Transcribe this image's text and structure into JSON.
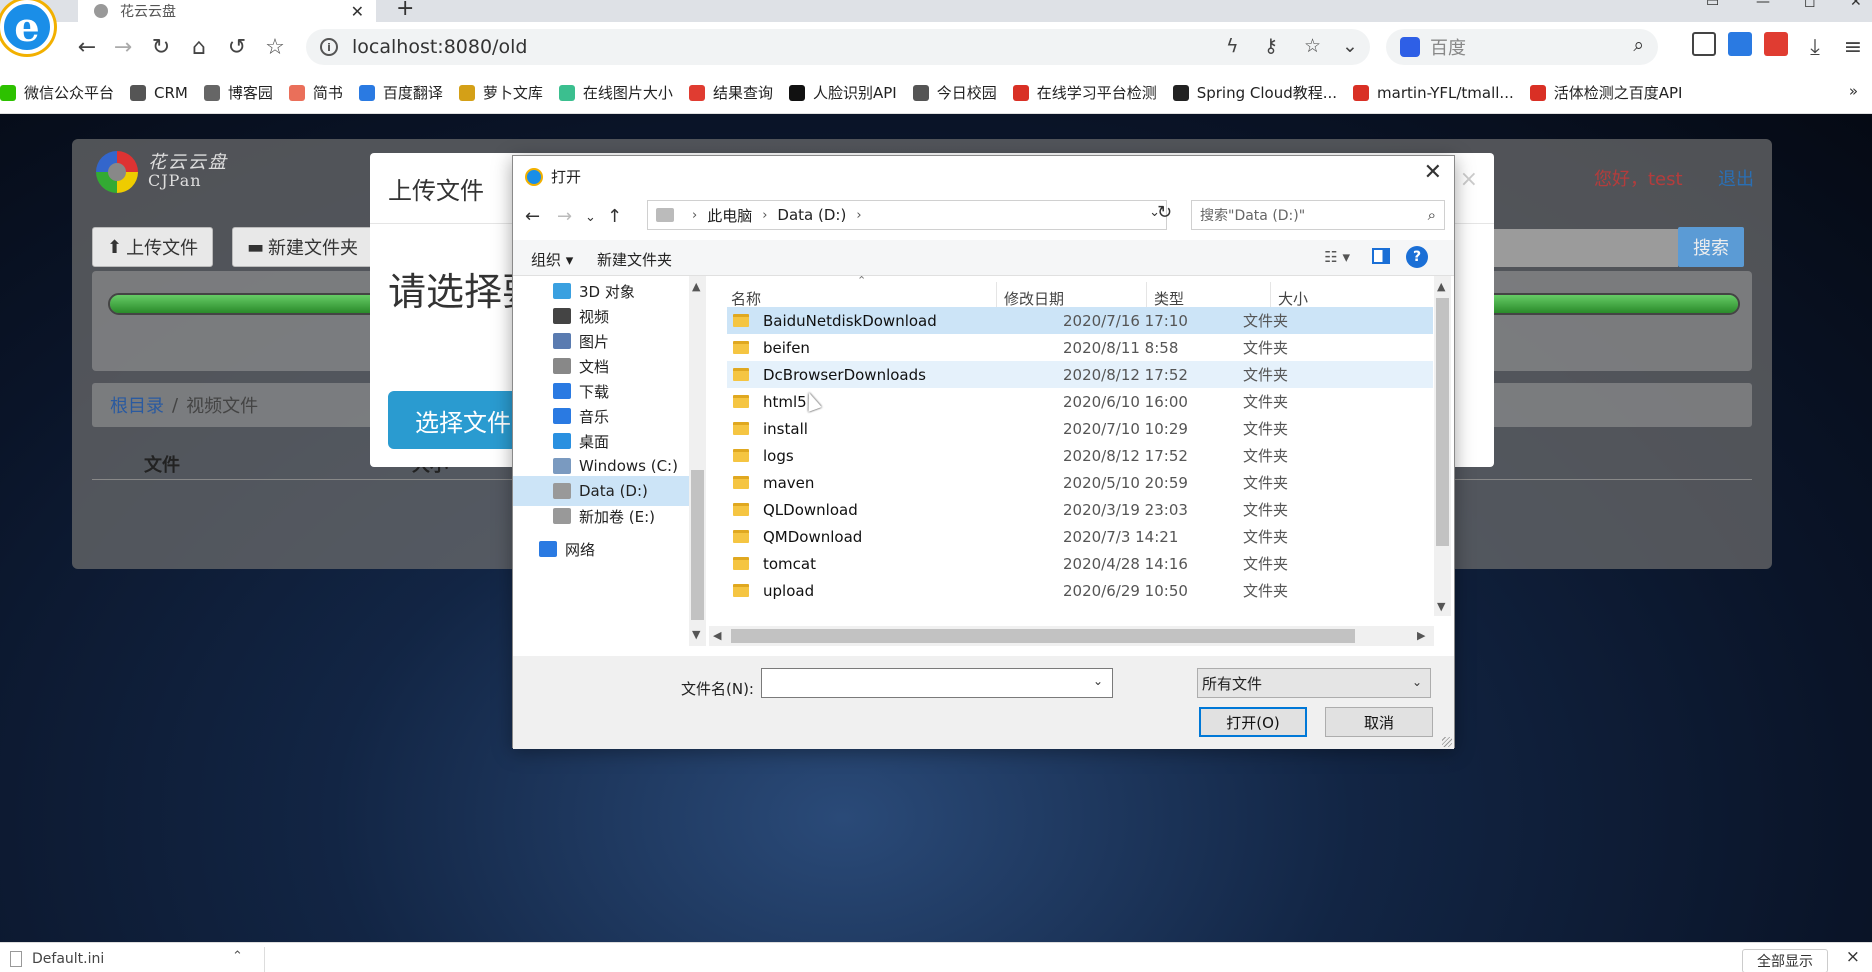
{
  "browser": {
    "tab_title": "花云云盘",
    "url": "localhost:8080/old",
    "search_placeholder": "百度",
    "bookmarks": [
      {
        "label": "微信公众平台",
        "color": "#2dc100"
      },
      {
        "label": "CRM",
        "color": "#555555"
      },
      {
        "label": "博客园",
        "color": "#666666"
      },
      {
        "label": "简书",
        "color": "#ea6f5a"
      },
      {
        "label": "百度翻译",
        "color": "#2a7ae2"
      },
      {
        "label": "萝卜文库",
        "color": "#d4a017"
      },
      {
        "label": "在线图片大小",
        "color": "#3bbf8f"
      },
      {
        "label": "结果查询",
        "color": "#e03c31"
      },
      {
        "label": "人脸识别API",
        "color": "#111111"
      },
      {
        "label": "今日校园",
        "color": "#555555"
      },
      {
        "label": "在线学习平台检测",
        "color": "#d93025"
      },
      {
        "label": "Spring Cloud教程...",
        "color": "#222222"
      },
      {
        "label": "martin-YFL/tmall...",
        "color": "#d93025"
      },
      {
        "label": "活体检测之百度API",
        "color": "#d93025"
      }
    ],
    "bookmarks_more": "»"
  },
  "app": {
    "logo_line1": "花云云盘",
    "logo_line2": "CJPan",
    "greeting": "您好，test",
    "logout": "退出",
    "upload_btn": "上传文件",
    "new_folder_btn": "新建文件夹",
    "search_btn": "搜索",
    "progress": 1.0,
    "breadcrumb_root": "根目录",
    "breadcrumb_sep": "/",
    "breadcrumb_current": "视频文件",
    "columns": [
      "文件",
      "大小"
    ]
  },
  "upload_modal": {
    "title": "上传文件",
    "close": "×",
    "prompt": "请选择要",
    "choose_btn": "选择文件"
  },
  "dialog": {
    "title": "打开",
    "path": [
      "此电脑",
      "Data (D:)"
    ],
    "search_placeholder": "搜索\"Data (D:)\"",
    "organize": "组织 ▾",
    "new_folder": "新建文件夹",
    "help": "?",
    "nav_items": [
      {
        "label": "3D 对象",
        "icon": "cube-icon",
        "color": "#3aa0e0",
        "selected": false
      },
      {
        "label": "视频",
        "icon": "video-icon",
        "color": "#444444",
        "selected": false
      },
      {
        "label": "图片",
        "icon": "picture-icon",
        "color": "#5a7bb0",
        "selected": false
      },
      {
        "label": "文档",
        "icon": "document-icon",
        "color": "#888888",
        "selected": false
      },
      {
        "label": "下载",
        "icon": "download-icon",
        "color": "#2a7ae2",
        "selected": false
      },
      {
        "label": "音乐",
        "icon": "music-icon",
        "color": "#2a7ae2",
        "selected": false
      },
      {
        "label": "桌面",
        "icon": "desktop-icon",
        "color": "#2a90e0",
        "selected": false
      },
      {
        "label": "Windows (C:)",
        "icon": "drive-icon",
        "color": "#7a9ac0",
        "selected": false
      },
      {
        "label": "Data (D:)",
        "icon": "drive-icon",
        "color": "#999999",
        "selected": true
      },
      {
        "label": "新加卷 (E:)",
        "icon": "drive-icon",
        "color": "#999999",
        "selected": false
      },
      {
        "label": "网络",
        "icon": "network-icon",
        "color": "#2a7ae2",
        "selected": false
      }
    ],
    "headers": {
      "name": "名称",
      "date": "修改日期",
      "type": "类型",
      "size": "大小"
    },
    "files": [
      {
        "name": "BaiduNetdiskDownload",
        "date": "2020/7/16 17:10",
        "type": "文件夹",
        "state": "selected"
      },
      {
        "name": "beifen",
        "date": "2020/8/11 8:58",
        "type": "文件夹",
        "state": ""
      },
      {
        "name": "DcBrowserDownloads",
        "date": "2020/8/12 17:52",
        "type": "文件夹",
        "state": "hover"
      },
      {
        "name": "html5",
        "date": "2020/6/10 16:00",
        "type": "文件夹",
        "state": ""
      },
      {
        "name": "install",
        "date": "2020/7/10 10:29",
        "type": "文件夹",
        "state": ""
      },
      {
        "name": "logs",
        "date": "2020/8/12 17:52",
        "type": "文件夹",
        "state": ""
      },
      {
        "name": "maven",
        "date": "2020/5/10 20:59",
        "type": "文件夹",
        "state": ""
      },
      {
        "name": "QLDownload",
        "date": "2020/3/19 23:03",
        "type": "文件夹",
        "state": ""
      },
      {
        "name": "QMDownload",
        "date": "2020/7/3 14:21",
        "type": "文件夹",
        "state": ""
      },
      {
        "name": "tomcat",
        "date": "2020/4/28 14:16",
        "type": "文件夹",
        "state": ""
      },
      {
        "name": "upload",
        "date": "2020/6/29 10:50",
        "type": "文件夹",
        "state": ""
      }
    ],
    "filename_label": "文件名(N):",
    "filename_value": "",
    "filetype": "所有文件",
    "open_btn": "打开(O)",
    "cancel_btn": "取消"
  },
  "download_bar": {
    "item": "Default.ini",
    "show_all": "全部显示",
    "close": "×"
  }
}
